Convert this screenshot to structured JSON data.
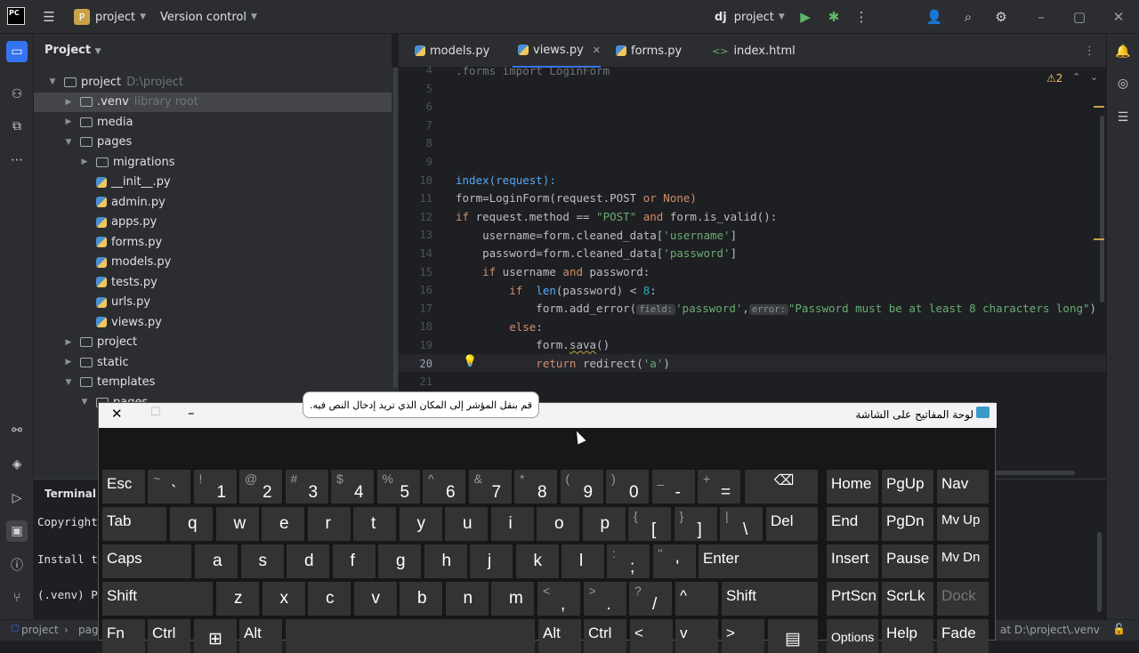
{
  "titlebar": {
    "app_icon": "PC",
    "project_badge": "P",
    "project_name": "project",
    "vcs": "Version control",
    "dj_logo": "dj",
    "run_config": "project"
  },
  "project_panel": {
    "title": "Project",
    "rows": [
      {
        "name": "project",
        "hint": "D:\\project",
        "kind": "folder",
        "depth": 0,
        "open": true
      },
      {
        "name": ".venv",
        "hint": "library root",
        "kind": "folder",
        "depth": 1,
        "open": false,
        "selected": true
      },
      {
        "name": "media",
        "hint": "",
        "kind": "folder",
        "depth": 1,
        "open": false
      },
      {
        "name": "pages",
        "hint": "",
        "kind": "folder",
        "depth": 1,
        "open": true
      },
      {
        "name": "migrations",
        "hint": "",
        "kind": "folder",
        "depth": 2,
        "open": false
      },
      {
        "name": "__init__.py",
        "hint": "",
        "kind": "py",
        "depth": 2
      },
      {
        "name": "admin.py",
        "hint": "",
        "kind": "py",
        "depth": 2
      },
      {
        "name": "apps.py",
        "hint": "",
        "kind": "py",
        "depth": 2
      },
      {
        "name": "forms.py",
        "hint": "",
        "kind": "py",
        "depth": 2
      },
      {
        "name": "models.py",
        "hint": "",
        "kind": "py",
        "depth": 2
      },
      {
        "name": "tests.py",
        "hint": "",
        "kind": "py",
        "depth": 2
      },
      {
        "name": "urls.py",
        "hint": "",
        "kind": "py",
        "depth": 2
      },
      {
        "name": "views.py",
        "hint": "",
        "kind": "py",
        "depth": 2
      },
      {
        "name": "project",
        "hint": "",
        "kind": "folder",
        "depth": 1,
        "open": false
      },
      {
        "name": "static",
        "hint": "",
        "kind": "folder",
        "depth": 1,
        "open": false
      },
      {
        "name": "templates",
        "hint": "",
        "kind": "folder",
        "depth": 1,
        "open": true
      },
      {
        "name": "pages",
        "hint": "",
        "kind": "folder",
        "depth": 2,
        "open": true
      }
    ]
  },
  "tabs": [
    {
      "label": "models.py"
    },
    {
      "label": "views.py",
      "active": true
    },
    {
      "label": "forms.py"
    },
    {
      "label": "index.html"
    }
  ],
  "editor": {
    "warnings": "⚠2",
    "lines": [
      "4",
      "5",
      "6",
      "7",
      "8",
      "9",
      "10",
      "11",
      "12",
      "13",
      "14",
      "15",
      "16",
      "17",
      "18",
      "19",
      "20",
      "21"
    ],
    "hints": {
      "field": "field:",
      "error": "error:"
    },
    "code": {
      "l4": ".forms import LoginForm",
      "l10": "index(request):",
      "l11a": "form=LoginForm(request.POST ",
      "l11b": "or",
      "l11c": " None)",
      "l12a": "if",
      "l12b": " request.method == ",
      "l12c": "\"POST\"",
      "l12d": " and",
      "l12e": " form.is_valid():",
      "l13a": "    username=form.cleaned_data[",
      "l13b": "'username'",
      "l13c": "]",
      "l14a": "    password=form.cleaned_data[",
      "l14b": "'password'",
      "l14c": "]",
      "l15a": "    if",
      "l15b": " username ",
      "l15c": "and",
      "l15d": " password:",
      "l16a": "        if",
      "l16b": "  len",
      "l16c": "(password) < ",
      "l16d": "8",
      "l16e": ":",
      "l17a": "            form.add_error(",
      "l17b": "'password'",
      "l17c": ",",
      "l17d": "\"Password must be at least 8 characters long\"",
      "l17e": ")",
      "l18a": "        else",
      ":l18b": "",
      "l18c": ":",
      "l19a": "            form.",
      "l19b": "sava",
      "l19c": "()",
      "l20a": "            return",
      "l20b": " redirect(",
      "l20c": "'a'",
      "l20d": ")"
    }
  },
  "terminal": {
    "title": "Terminal",
    "lines": [
      "Copyright",
      "Install t",
      "(.venv) P"
    ]
  },
  "status": {
    "crumb1": "project",
    "crumb2": "pag",
    "right": "at D:\\project\\.venv"
  },
  "osk": {
    "title": "لوحة المفاتيح على الشاشة",
    "tooltip": "قم بنقل المؤشر إلى المكان الذي تريد إدخال النص فيه.",
    "row1": [
      {
        "t": "~",
        "b": "`"
      },
      {
        "t": "!",
        "b": "1"
      },
      {
        "t": "@",
        "b": "2"
      },
      {
        "t": "#",
        "b": "3"
      },
      {
        "t": "$",
        "b": "4"
      },
      {
        "t": "%",
        "b": "5"
      },
      {
        "t": "^",
        "b": "6"
      },
      {
        "t": "&",
        "b": "7"
      },
      {
        "t": "*",
        "b": "8"
      },
      {
        "t": "(",
        "b": "9"
      },
      {
        "t": ")",
        "b": "0"
      },
      {
        "t": "_",
        "b": "-"
      },
      {
        "t": "+",
        "b": "="
      }
    ],
    "row2": [
      "q",
      "w",
      "e",
      "r",
      "t",
      "y",
      "u",
      "i",
      "o",
      "p"
    ],
    "row2b": [
      {
        "t": "{",
        "b": "["
      },
      {
        "t": "}",
        "b": "]"
      },
      {
        "t": "|",
        "b": "\\"
      }
    ],
    "row3": [
      "a",
      "s",
      "d",
      "f",
      "g",
      "h",
      "j",
      "k",
      "l"
    ],
    "row3b": [
      {
        "t": ":",
        "b": ";"
      },
      {
        "t": "\"",
        "b": "'"
      }
    ],
    "row4": [
      "z",
      "x",
      "c",
      "v",
      "b",
      "n",
      "m"
    ],
    "row4b": [
      {
        "t": "<",
        "b": ","
      },
      {
        "t": ">",
        "b": "."
      },
      {
        "t": "?",
        "b": "/"
      }
    ],
    "labels": {
      "esc": "Esc",
      "tab": "Tab",
      "caps": "Caps",
      "shift": "Shift",
      "fn": "Fn",
      "ctrl": "Ctrl",
      "alt": "Alt",
      "del": "Del",
      "enter": "Enter",
      "home": "Home",
      "pgup": "PgUp",
      "nav": "Nav",
      "end": "End",
      "pgdn": "PgDn",
      "mvup": "Mv Up",
      "insert": "Insert",
      "pause": "Pause",
      "mvdn": "Mv Dn",
      "prtscn": "PrtScn",
      "scrlk": "ScrLk",
      "dock": "Dock",
      "options": "Options",
      "help": "Help",
      "fade": "Fade",
      "up": "^",
      "left": "<",
      "down": "v",
      "right": ">"
    }
  }
}
